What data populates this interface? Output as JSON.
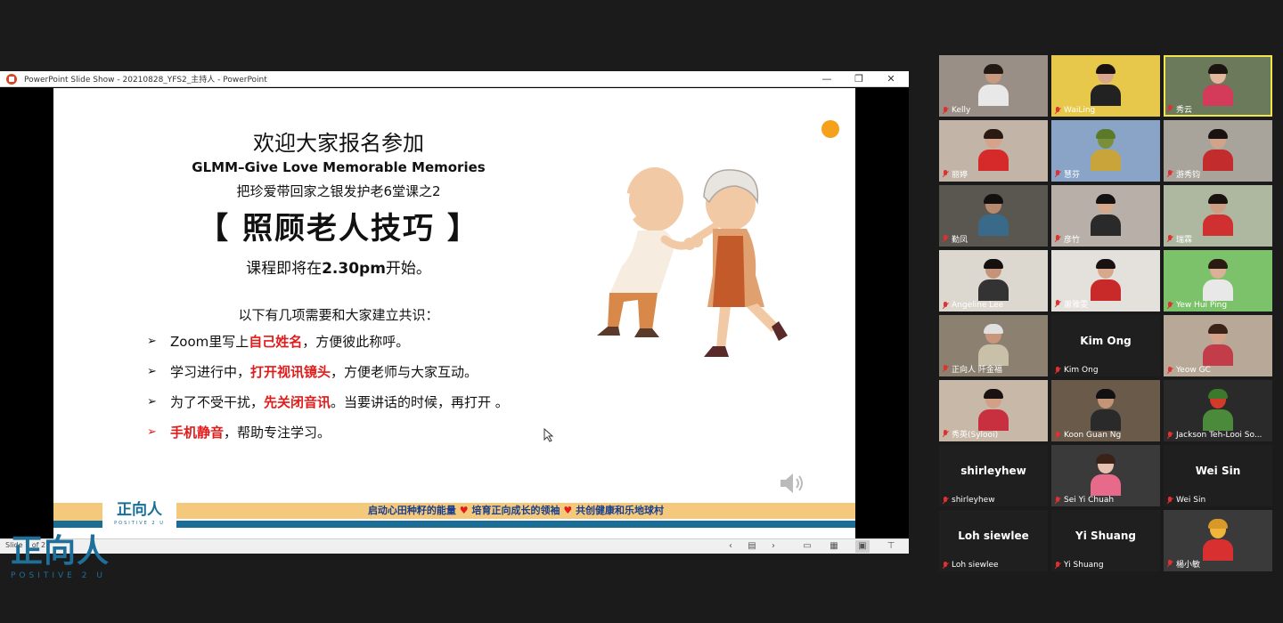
{
  "ppt": {
    "window_title": "PowerPoint Slide Show  -  20210828_YFS2_主持人 - PowerPoint",
    "controls": [
      "—",
      "❐",
      "✕"
    ],
    "slide_counter": "Slide 7 of 27"
  },
  "slide": {
    "title": "欢迎大家报名参加",
    "glmm": "GLMM–Give Love Memorable Memories",
    "course": "把珍爱带回家之银发护老6堂课之2",
    "topic": "【 照顾老人技巧 】",
    "start_prefix": "课程即将在",
    "start_time": "2.30pm",
    "start_suffix": "开始。",
    "intro": "以下有几项需要和大家建立共识：",
    "rules": [
      {
        "arrow": "➢",
        "pre": "Zoom里写上",
        "hl": "自己姓名",
        "post": "，方便彼此称呼。"
      },
      {
        "arrow": "➢",
        "pre": "学习进行中，",
        "hl": "打开视讯镜头",
        "post": "，方便老师与大家互动。"
      },
      {
        "arrow": "➢",
        "pre": "为了不受干扰，",
        "hl": "先关闭音讯",
        "post": "。当要讲话的时候，再打开 。"
      },
      {
        "arrow": "➢",
        "pre": "",
        "hl": "手机静音",
        "post": "，帮助专注学习。"
      }
    ],
    "footer_logo_zh": "正向人",
    "footer_logo_en": "POSITIVE 2 U",
    "slogan_1": "启动心田种籽的能量",
    "slogan_2": "培育正向成长的领袖",
    "slogan_3": "共创健康和乐地球村",
    "heart": "♥"
  },
  "brand": {
    "zh": "正向人",
    "en": "POSITIVE 2 U"
  },
  "participants": [
    {
      "name": "Kelly",
      "bg": "#9a8f86",
      "skin": "#c79a80",
      "shirt": "#e8e8e8",
      "hair": "#221814"
    },
    {
      "name": "WaiLing",
      "bg": "#e8c84a",
      "skin": "#d9a88c",
      "shirt": "#222",
      "hair": "#1a1210"
    },
    {
      "name": "秀云",
      "bg": "#6a7a5a",
      "skin": "#e3b69e",
      "shirt": "#d43a5a",
      "hair": "#1c1410"
    },
    {
      "name": "丽婷",
      "bg": "#c2b4a6",
      "skin": "#d5a389",
      "shirt": "#d62a2a",
      "hair": "#2a1a12"
    },
    {
      "name": "慧芬",
      "bg": "#8aa4c8",
      "skin": "#7a8f3a",
      "shirt": "#c8a43a",
      "hair": "#5a7a2a"
    },
    {
      "name": "游秀钧",
      "bg": "#a8a49c",
      "skin": "#d1a48a",
      "shirt": "#c22c2c",
      "hair": "#1a1210"
    },
    {
      "name": "勤凤",
      "bg": "#5a5650",
      "skin": "#b58a6e",
      "shirt": "#3a6a8a",
      "hair": "#141010"
    },
    {
      "name": "彦竹",
      "bg": "#b8b0a8",
      "skin": "#d6a88c",
      "shirt": "#2a2a2a",
      "hair": "#121010"
    },
    {
      "name": "瑞霖",
      "bg": "#aeb8a0",
      "skin": "#cf9f85",
      "shirt": "#d03030",
      "hair": "#1a1210"
    },
    {
      "name": "Angeline Lee",
      "bg": "#dcd8d0",
      "skin": "#c59378",
      "shirt": "#333",
      "hair": "#141010"
    },
    {
      "name": "蕭雅雯",
      "bg": "#e4e0dc",
      "skin": "#d8a88c",
      "shirt": "#c82a2a",
      "hair": "#1a1210"
    },
    {
      "name": "Yew Hui Ping",
      "bg": "#7cc26a",
      "skin": "#dbb096",
      "shirt": "#e8e8e8",
      "hair": "#2a1a12"
    },
    {
      "name": "正向人 阡金福",
      "bg": "#8c8070",
      "skin": "#c8967a",
      "shirt": "#c8c0a8",
      "hair": "#e0e0e0"
    },
    {
      "name": "Kim Ong",
      "placeholder": "Kim Ong"
    },
    {
      "name": "Yeow GC",
      "bg": "#b8a898",
      "skin": "#d5a389",
      "shirt": "#c33c4a",
      "hair": "#3a2218"
    },
    {
      "name": "秀英(Sylooi)",
      "bg": "#c8b8a8",
      "skin": "#d1a086",
      "shirt": "#c83040",
      "hair": "#1a1210"
    },
    {
      "name": "Koon Guan Ng",
      "bg": "#6a5a4a",
      "skin": "#c49478",
      "shirt": "#2a2a2a",
      "hair": "#121010"
    },
    {
      "name": "Jackson Teh-Looi So...",
      "bg": "#2a2a2a",
      "skin": "#d23a2a",
      "shirt": "#4a8a3a",
      "hair": "#3a7a2a"
    },
    {
      "name": "shirleyhew",
      "placeholder": "shirleyhew"
    },
    {
      "name": "Sei Yi Chuah",
      "bg": "#3a3a3a",
      "skin": "#e6c0b0",
      "shirt": "#e86a8a",
      "hair": "#3a2218"
    },
    {
      "name": "Wei Sin",
      "placeholder": "Wei Sin"
    },
    {
      "name": "Loh siewlee",
      "placeholder": "Loh siewlee"
    },
    {
      "name": "Yi Shuang",
      "placeholder": "Yi Shuang"
    },
    {
      "name": "楊小敏",
      "bg": "#3a3a3a",
      "skin": "#f0b63a",
      "shirt": "#d83030",
      "hair": "#d8982a"
    }
  ]
}
